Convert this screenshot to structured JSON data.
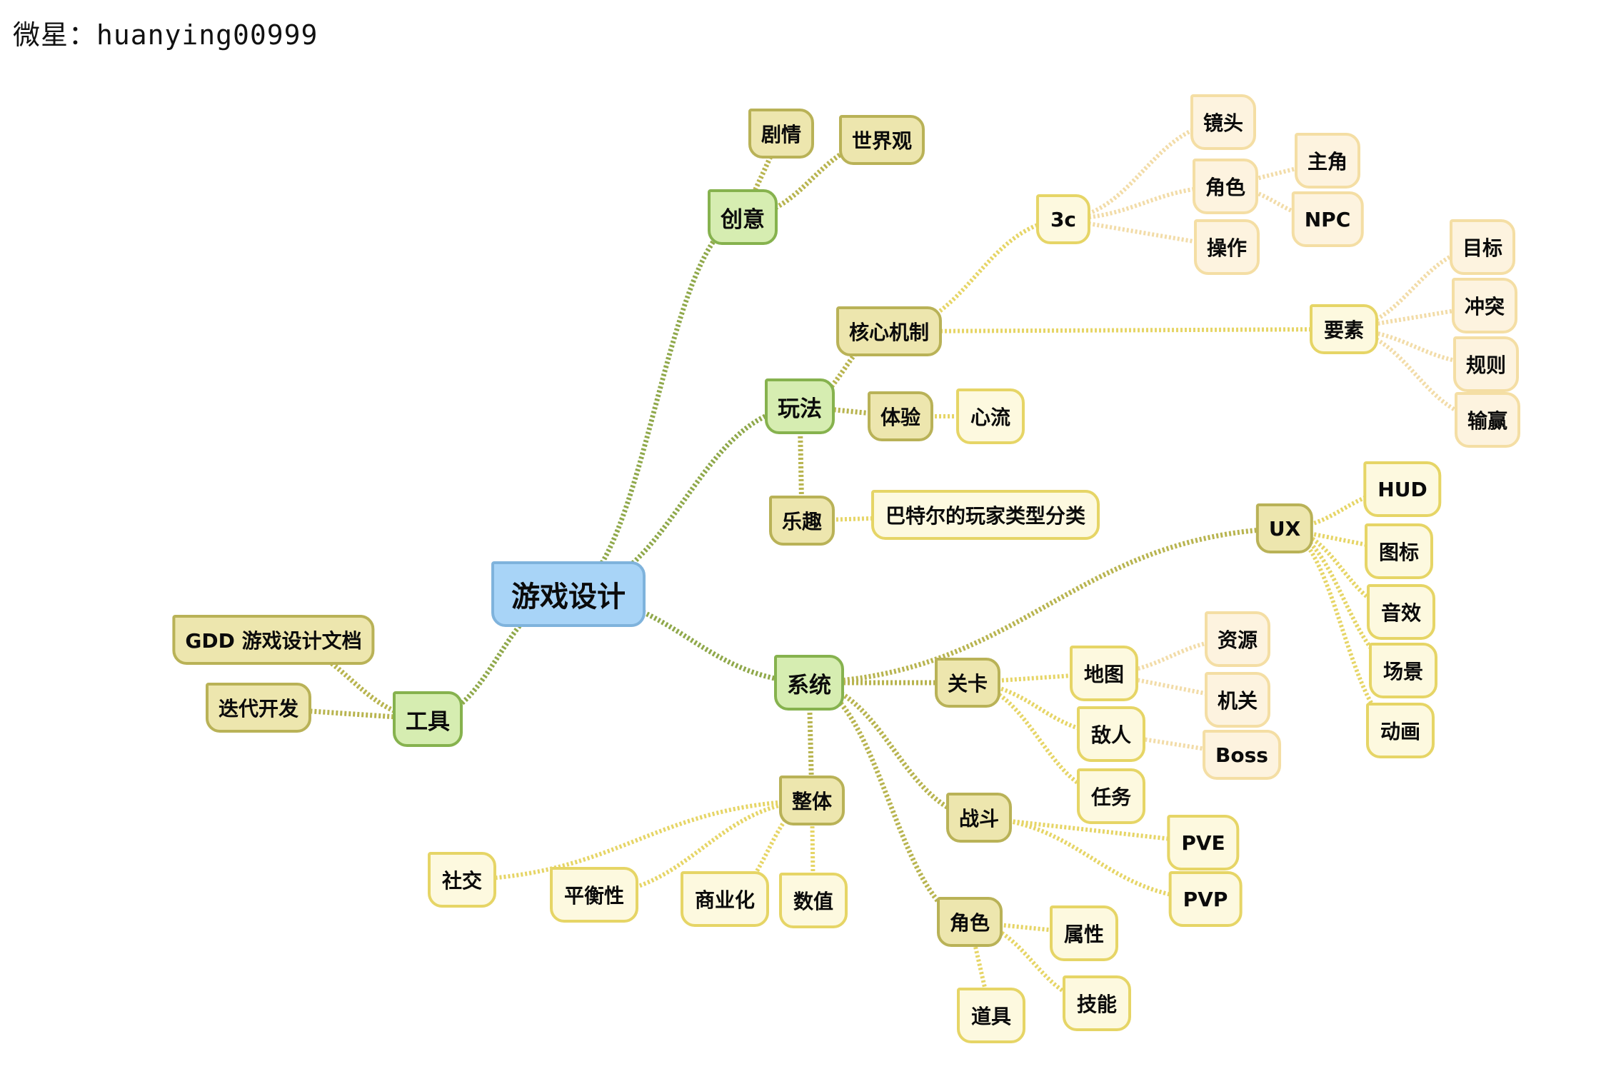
{
  "watermark": "微星：huanying00999",
  "colors": {
    "root_fill": "#a8d4f7",
    "level1_fill": "#d6edb1",
    "level2_fill": "#ede6ae",
    "level3_fill": "#fdf9df",
    "level4_fill": "#fdf3df",
    "edge_level1": "#8fa84a",
    "edge_level2": "#b8b44f",
    "edge_level3": "#e6d566",
    "edge_level4": "#f2dca8"
  },
  "mindmap": {
    "root": {
      "id": "root",
      "label": "游戏设计"
    },
    "nodes": [
      {
        "id": "chuangyi",
        "label": "创意",
        "parent": "root",
        "level": 1
      },
      {
        "id": "juqing",
        "label": "剧情",
        "parent": "chuangyi",
        "level": 2
      },
      {
        "id": "shijieguan",
        "label": "世界观",
        "parent": "chuangyi",
        "level": 2
      },
      {
        "id": "wanfa",
        "label": "玩法",
        "parent": "root",
        "level": 1
      },
      {
        "id": "hexinjizhi",
        "label": "核心机制",
        "parent": "wanfa",
        "level": 2
      },
      {
        "id": "3c",
        "label": "3c",
        "parent": "hexinjizhi",
        "level": 3
      },
      {
        "id": "jingtou",
        "label": "镜头",
        "parent": "3c",
        "level": 4
      },
      {
        "id": "juese3c",
        "label": "角色",
        "parent": "3c",
        "level": 4
      },
      {
        "id": "caozuo",
        "label": "操作",
        "parent": "3c",
        "level": 4
      },
      {
        "id": "zhujiao",
        "label": "主角",
        "parent": "juese3c",
        "level": 4
      },
      {
        "id": "npc",
        "label": "NPC",
        "parent": "juese3c",
        "level": 4
      },
      {
        "id": "yaosu",
        "label": "要素",
        "parent": "hexinjizhi",
        "level": 3
      },
      {
        "id": "mubiao",
        "label": "目标",
        "parent": "yaosu",
        "level": 4
      },
      {
        "id": "chongtu",
        "label": "冲突",
        "parent": "yaosu",
        "level": 4
      },
      {
        "id": "guize",
        "label": "规则",
        "parent": "yaosu",
        "level": 4
      },
      {
        "id": "shuying",
        "label": "输赢",
        "parent": "yaosu",
        "level": 4
      },
      {
        "id": "tiyan",
        "label": "体验",
        "parent": "wanfa",
        "level": 2
      },
      {
        "id": "xinliu",
        "label": "心流",
        "parent": "tiyan",
        "level": 3
      },
      {
        "id": "lequ",
        "label": "乐趣",
        "parent": "wanfa",
        "level": 2
      },
      {
        "id": "bartle",
        "label": "巴特尔的玩家类型分类",
        "parent": "lequ",
        "level": 3
      },
      {
        "id": "xitong",
        "label": "系统",
        "parent": "root",
        "level": 1
      },
      {
        "id": "ux",
        "label": "UX",
        "parent": "xitong",
        "level": 2
      },
      {
        "id": "hud",
        "label": "HUD",
        "parent": "ux",
        "level": 3
      },
      {
        "id": "tubiao",
        "label": "图标",
        "parent": "ux",
        "level": 3
      },
      {
        "id": "yinxiao",
        "label": "音效",
        "parent": "ux",
        "level": 3
      },
      {
        "id": "changjing",
        "label": "场景",
        "parent": "ux",
        "level": 3
      },
      {
        "id": "donghua",
        "label": "动画",
        "parent": "ux",
        "level": 3
      },
      {
        "id": "guanka",
        "label": "关卡",
        "parent": "xitong",
        "level": 2
      },
      {
        "id": "ditu",
        "label": "地图",
        "parent": "guanka",
        "level": 3
      },
      {
        "id": "ziyuan",
        "label": "资源",
        "parent": "ditu",
        "level": 4
      },
      {
        "id": "jiguan",
        "label": "机关",
        "parent": "ditu",
        "level": 4
      },
      {
        "id": "diren",
        "label": "敌人",
        "parent": "guanka",
        "level": 3
      },
      {
        "id": "boss",
        "label": "Boss",
        "parent": "diren",
        "level": 4
      },
      {
        "id": "renwu",
        "label": "任务",
        "parent": "guanka",
        "level": 3
      },
      {
        "id": "zhandou",
        "label": "战斗",
        "parent": "xitong",
        "level": 2
      },
      {
        "id": "pve",
        "label": "PVE",
        "parent": "zhandou",
        "level": 3
      },
      {
        "id": "pvp",
        "label": "PVP",
        "parent": "zhandou",
        "level": 3
      },
      {
        "id": "juese",
        "label": "角色",
        "parent": "xitong",
        "level": 2
      },
      {
        "id": "shuxing",
        "label": "属性",
        "parent": "juese",
        "level": 3
      },
      {
        "id": "jineng",
        "label": "技能",
        "parent": "juese",
        "level": 3
      },
      {
        "id": "daoju",
        "label": "道具",
        "parent": "juese",
        "level": 3
      },
      {
        "id": "zhengti",
        "label": "整体",
        "parent": "xitong",
        "level": 2
      },
      {
        "id": "shejiao",
        "label": "社交",
        "parent": "zhengti",
        "level": 3
      },
      {
        "id": "pinghengxing",
        "label": "平衡性",
        "parent": "zhengti",
        "level": 3
      },
      {
        "id": "shangyehua",
        "label": "商业化",
        "parent": "zhengti",
        "level": 3
      },
      {
        "id": "shuzhi",
        "label": "数值",
        "parent": "zhengti",
        "level": 3
      },
      {
        "id": "gongju",
        "label": "工具",
        "parent": "root",
        "level": 1
      },
      {
        "id": "gdd",
        "label": "GDD 游戏设计文档",
        "parent": "gongju",
        "level": 2
      },
      {
        "id": "diedai",
        "label": "迭代开发",
        "parent": "gongju",
        "level": 2
      }
    ]
  }
}
